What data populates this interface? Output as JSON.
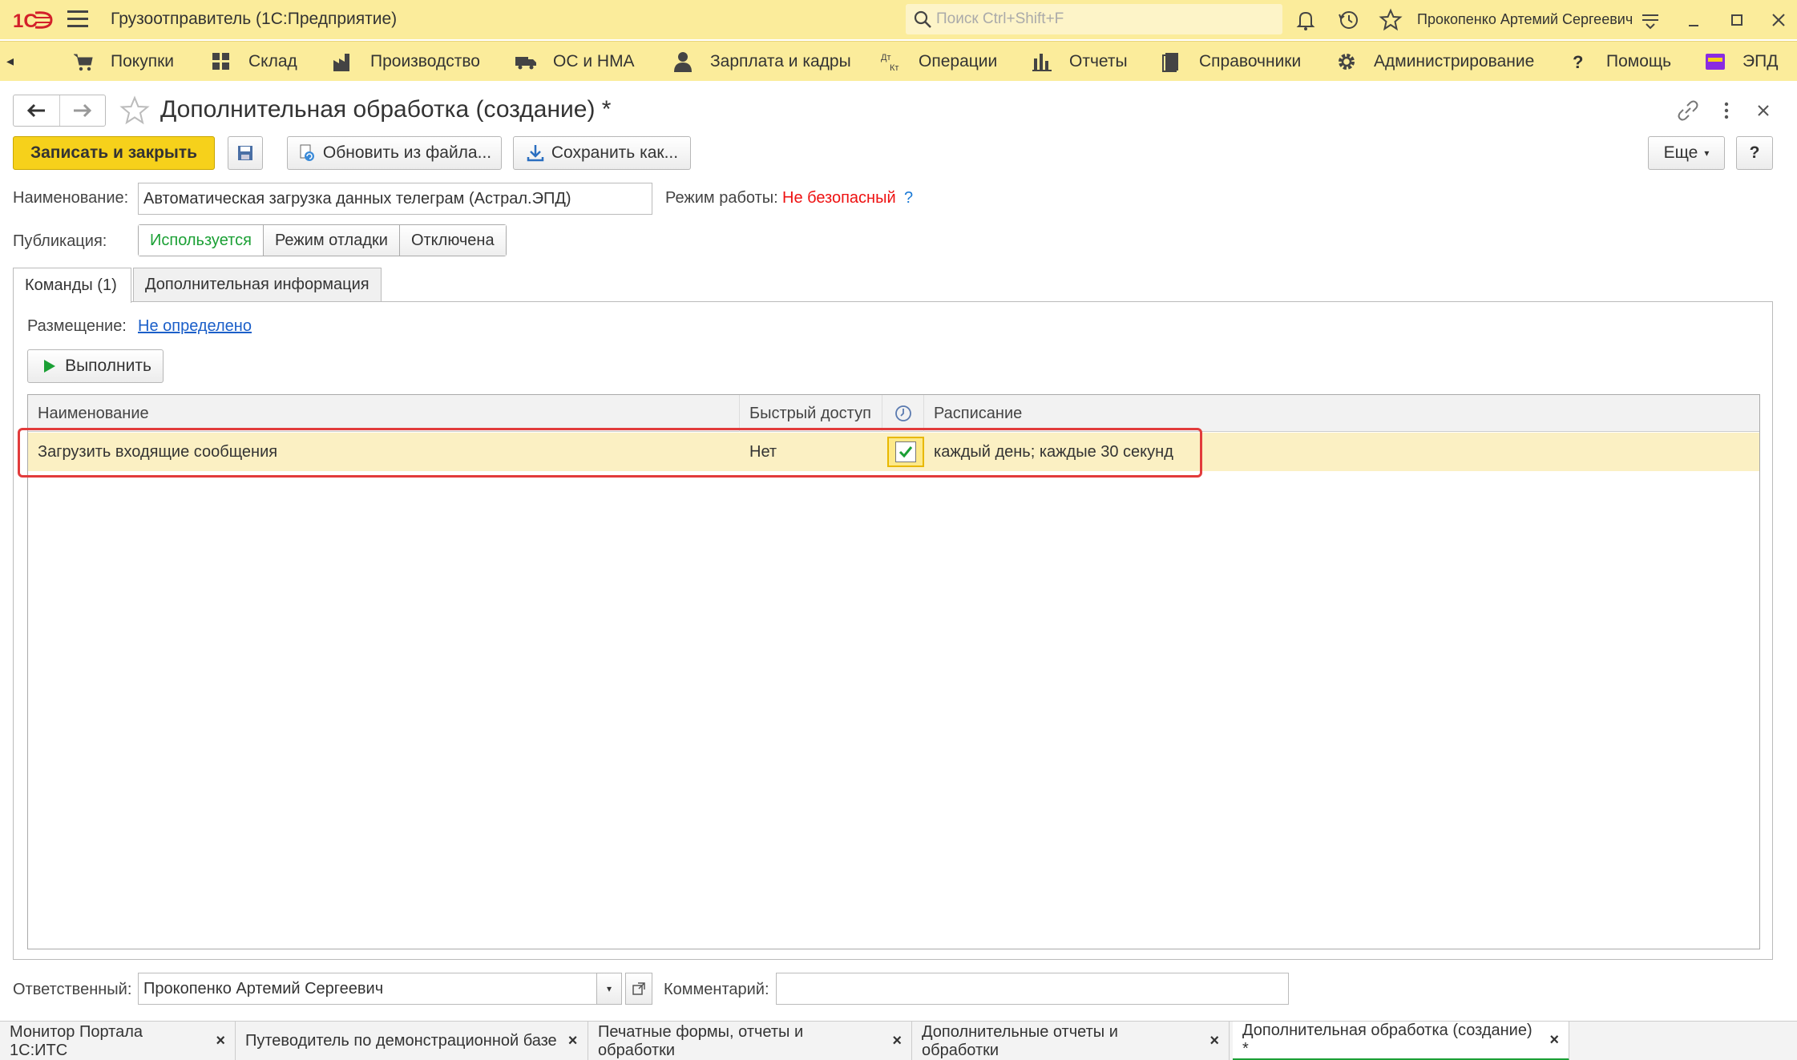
{
  "app": {
    "title": "Грузоотправитель (1С:Предприятие)",
    "search_placeholder": "Поиск Ctrl+Shift+F",
    "user": "Прокопенко Артемий Сергеевич",
    "logo_text": "1С"
  },
  "menu": {
    "items": [
      {
        "label": "Покупки",
        "icon": "cart-icon"
      },
      {
        "label": "Склад",
        "icon": "warehouse-icon"
      },
      {
        "label": "Производство",
        "icon": "factory-icon"
      },
      {
        "label": "ОС и НМА",
        "icon": "truck-icon"
      },
      {
        "label": "Зарплата и кадры",
        "icon": "person-icon"
      },
      {
        "label": "Операции",
        "icon": "operations-icon"
      },
      {
        "label": "Отчеты",
        "icon": "chart-icon"
      },
      {
        "label": "Справочники",
        "icon": "book-icon"
      },
      {
        "label": "Администрирование",
        "icon": "gear-icon"
      },
      {
        "label": "Помощь",
        "icon": "help-icon"
      },
      {
        "label": "ЭПД",
        "icon": "folder-icon"
      }
    ]
  },
  "form": {
    "title": "Дополнительная обработка (создание) *",
    "save_close": "Записать и закрыть",
    "update_from_file": "Обновить из файла...",
    "save_as": "Сохранить как...",
    "more": "Еще",
    "help": "?",
    "name_label": "Наименование:",
    "name_value": "Автоматическая загрузка данных телеграм (Астрал.ЭПД)",
    "mode_label": "Режим работы:",
    "mode_value": "Не безопасный",
    "mode_help": "?",
    "publication_label": "Публикация:",
    "publication_options": [
      "Используется",
      "Режим отладки",
      "Отключена"
    ],
    "tabs": [
      "Команды (1)",
      "Дополнительная информация"
    ],
    "placement_label": "Размещение:",
    "placement_value": "Не определено",
    "run_button": "Выполнить",
    "grid": {
      "columns": [
        "Наименование",
        "Быстрый доступ",
        "",
        "Расписание"
      ],
      "rows": [
        {
          "name": "Загрузить входящие сообщения",
          "quick_access": "Нет",
          "scheduled": true,
          "schedule": "каждый день; каждые 30 секунд"
        }
      ]
    },
    "responsible_label": "Ответственный:",
    "responsible_value": "Прокопенко Артемий Сергеевич",
    "comment_label": "Комментарий:",
    "comment_value": ""
  },
  "bottom_tabs": [
    {
      "label": "Монитор Портала 1С:ИТС",
      "active": false
    },
    {
      "label": "Путеводитель по демонстрационной базе",
      "active": false
    },
    {
      "label": "Печатные формы, отчеты и обработки",
      "active": false
    },
    {
      "label": "Дополнительные отчеты и обработки",
      "active": false
    },
    {
      "label": "Дополнительная обработка (создание) *",
      "active": true
    }
  ],
  "colors": {
    "header_bg": "#fbec9b",
    "primary_button": "#f6d11b",
    "selected_row": "#fbf0c3",
    "highlight_border": "#e23b3b",
    "active_green": "#1ba035",
    "warning_red": "#e11111"
  }
}
